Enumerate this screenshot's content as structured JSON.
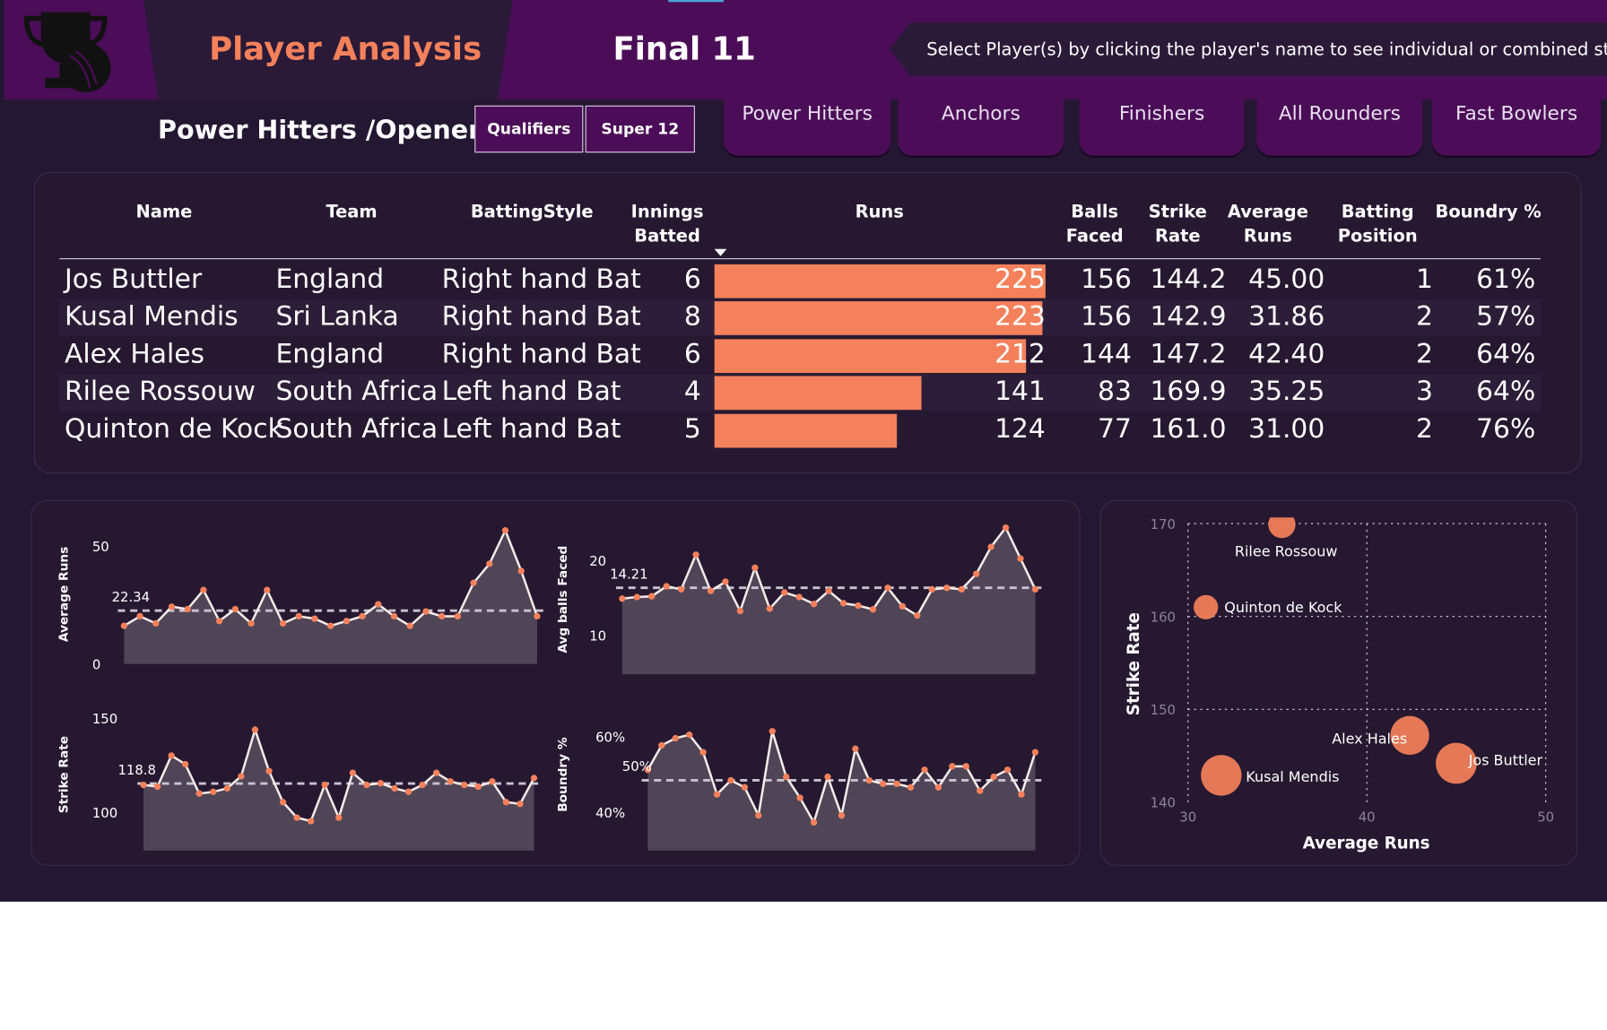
{
  "header": {
    "title": "Player Analysis",
    "final_label": "Final 11",
    "instruction": "Select Player(s) by clicking the player's name to see individual or combined strength",
    "trophy_icon": "trophy-icon"
  },
  "page": {
    "subtitle": "Power Hitters /Openers",
    "stage_buttons": [
      "Qualifiers",
      "Super 12"
    ],
    "category_tabs": [
      "Power Hitters",
      "Anchors",
      "Finishers",
      "All Rounders",
      "Fast Bowlers"
    ]
  },
  "colors": {
    "accent": "#f4815b",
    "header": "#4b0d57",
    "background": "#241732"
  },
  "table": {
    "columns": [
      "Name",
      "Team",
      "BattingStyle",
      "Innings Batted",
      "Runs",
      "Balls Faced",
      "Strike Rate",
      "Average Runs",
      "Batting Position",
      "Boundry %"
    ],
    "rows": [
      {
        "name": "Jos Buttler",
        "team": "England",
        "style": "Right hand Bat",
        "innings": "6",
        "runs": 225,
        "runs_label": "225",
        "balls": "156",
        "sr": "144.2",
        "avg": "45.00",
        "pos": "1",
        "boundary": "61%"
      },
      {
        "name": "Kusal Mendis",
        "team": "Sri Lanka",
        "style": "Right hand Bat",
        "innings": "8",
        "runs": 223,
        "runs_label": "223",
        "balls": "156",
        "sr": "142.9",
        "avg": "31.86",
        "pos": "2",
        "boundary": "57%"
      },
      {
        "name": "Alex Hales",
        "team": "England",
        "style": "Right hand Bat",
        "innings": "6",
        "runs": 212,
        "runs_label": "212",
        "balls": "144",
        "sr": "147.2",
        "avg": "42.40",
        "pos": "2",
        "boundary": "64%"
      },
      {
        "name": "Rilee Rossouw",
        "team": "South Africa",
        "style": "Left hand Bat",
        "innings": "4",
        "runs": 141,
        "runs_label": "141",
        "balls": "83",
        "sr": "169.9",
        "avg": "35.25",
        "pos": "3",
        "boundary": "64%"
      },
      {
        "name": "Quinton de Kock",
        "team": "South Africa",
        "style": "Left hand Bat",
        "innings": "5",
        "runs": 124,
        "runs_label": "124",
        "balls": "77",
        "sr": "161.0",
        "avg": "31.00",
        "pos": "2",
        "boundary": "76%"
      }
    ]
  },
  "chart_data": [
    {
      "type": "area",
      "ylabel": "Average Runs",
      "yticks": [
        "50",
        "0"
      ],
      "ylim": [
        0,
        55
      ],
      "reference_label": "22.34",
      "reference": 22.34,
      "values": [
        16,
        20,
        17,
        24,
        23,
        31,
        18,
        23,
        17,
        31,
        17,
        20,
        19,
        16,
        18,
        20,
        25,
        20,
        16,
        22,
        20,
        20,
        34,
        42,
        56,
        39,
        20
      ]
    },
    {
      "type": "area",
      "ylabel": "Avg balls Faced",
      "yticks": [
        "20",
        "10"
      ],
      "ylim": [
        3,
        22
      ],
      "reference_label": "14.21",
      "reference": 14.21,
      "values": [
        12.8,
        13,
        13.1,
        14.4,
        14,
        18.5,
        13.8,
        15.0,
        11.2,
        16.8,
        11.5,
        13.6,
        13.0,
        12.1,
        13.8,
        12.2,
        11.9,
        11.4,
        14.2,
        11.8,
        10.6,
        14.0,
        14.2,
        14.0,
        16.0,
        19.5,
        22.0,
        18.0,
        14.0
      ]
    },
    {
      "type": "area",
      "ylabel": "Strike Rate",
      "yticks": [
        "150",
        "100"
      ],
      "ylim": [
        80,
        162
      ],
      "reference_label": "118.8",
      "reference": 118.8,
      "values": [
        118,
        117,
        135,
        130,
        113,
        114,
        116,
        123,
        150,
        126,
        108,
        99,
        97,
        118,
        99,
        125,
        118,
        119,
        116,
        114,
        118,
        125,
        120,
        118,
        117,
        120,
        108,
        107,
        122
      ]
    },
    {
      "type": "area",
      "ylabel": "Boundry %",
      "yticks": [
        "60%",
        "40%"
      ],
      "ylim": [
        30,
        68
      ],
      "reference_label": "50%",
      "reference": 50,
      "values": [
        53,
        60,
        62,
        63,
        58,
        46,
        50,
        48,
        40,
        64,
        51,
        45,
        38,
        51,
        40,
        59,
        50,
        49,
        49,
        48,
        53,
        48,
        54,
        54,
        47,
        51,
        53,
        46,
        58
      ]
    },
    {
      "type": "scatter",
      "xlabel": "Average Runs",
      "ylabel": "Strike Rate",
      "xlim": [
        30,
        50
      ],
      "ylim": [
        140,
        170
      ],
      "xticks": [
        "30",
        "40",
        "50"
      ],
      "yticks": [
        "170",
        "160",
        "150",
        "140"
      ],
      "points": [
        {
          "label": "Rilee Rossouw",
          "x": 35.25,
          "y": 169.9,
          "size": 141
        },
        {
          "label": "Quinton de Kock",
          "x": 31.0,
          "y": 161.0,
          "size": 124
        },
        {
          "label": "Jos Buttler",
          "x": 45.0,
          "y": 144.2,
          "size": 225
        },
        {
          "label": "Alex Hales",
          "x": 42.4,
          "y": 147.2,
          "size": 212
        },
        {
          "label": "Kusal Mendis",
          "x": 31.86,
          "y": 142.9,
          "size": 223
        }
      ]
    }
  ]
}
